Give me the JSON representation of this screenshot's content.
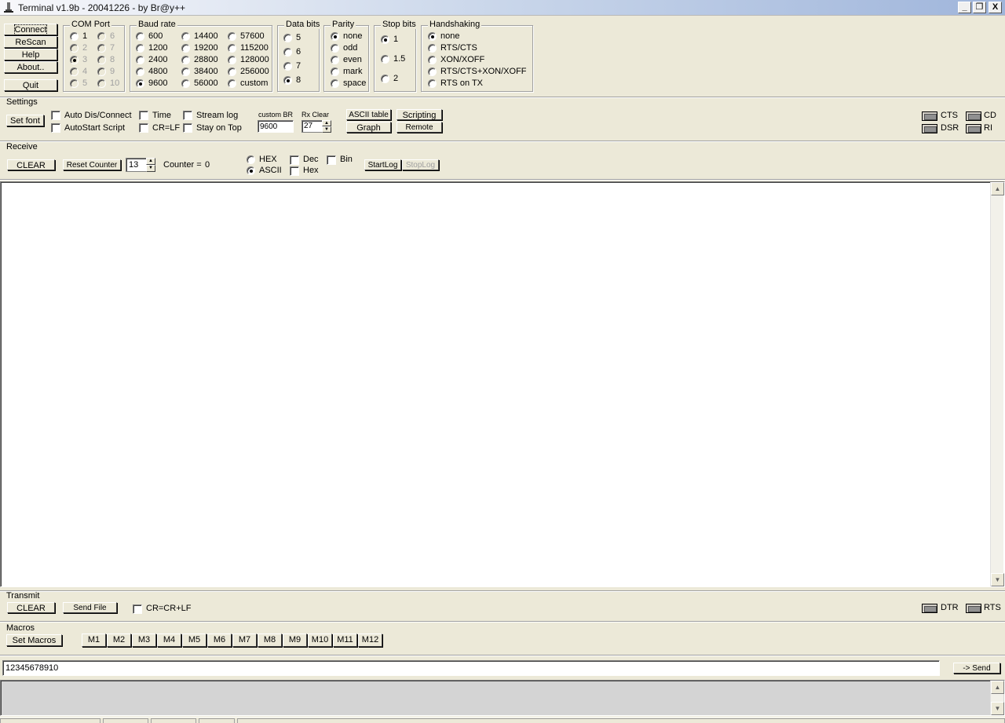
{
  "window": {
    "title": "Terminal v1.9b - 20041226 - by Br@y++",
    "minimize": "_",
    "restore": "❐",
    "close": "X"
  },
  "main_buttons": {
    "connect": "Connect",
    "rescan": "ReScan",
    "help": "Help",
    "about": "About..",
    "quit": "Quit"
  },
  "com_port": {
    "label": "COM Port",
    "options": [
      "1",
      "2",
      "3",
      "4",
      "5",
      "6",
      "7",
      "8",
      "9",
      "10"
    ],
    "selected": "3"
  },
  "baud_rate": {
    "label": "Baud rate",
    "options": [
      "600",
      "1200",
      "2400",
      "4800",
      "9600",
      "14400",
      "19200",
      "28800",
      "38400",
      "56000",
      "57600",
      "115200",
      "128000",
      "256000",
      "custom"
    ],
    "selected": "9600"
  },
  "data_bits": {
    "label": "Data bits",
    "options": [
      "5",
      "6",
      "7",
      "8"
    ],
    "selected": "8"
  },
  "parity": {
    "label": "Parity",
    "options": [
      "none",
      "odd",
      "even",
      "mark",
      "space"
    ],
    "selected": "none"
  },
  "stop_bits": {
    "label": "Stop bits",
    "options": [
      "1",
      "1.5",
      "2"
    ],
    "selected": "1"
  },
  "handshaking": {
    "label": "Handshaking",
    "options": [
      "none",
      "RTS/CTS",
      "XON/XOFF",
      "RTS/CTS+XON/XOFF",
      "RTS on TX"
    ],
    "selected": "none"
  },
  "settings": {
    "label": "Settings",
    "set_font": "Set font",
    "auto_dis_connect": "Auto Dis/Connect",
    "autostart_script": "AutoStart Script",
    "time": "Time",
    "cr_lf": "CR=LF",
    "stream_log": "Stream log",
    "stay_on_top": "Stay on Top",
    "custom_br_label": "custom BR",
    "custom_br_value": "9600",
    "rx_clear_label": "Rx Clear",
    "rx_clear_value": "27",
    "ascii_table": "ASCII table",
    "scripting": "Scripting",
    "graph": "Graph",
    "remote": "Remote"
  },
  "signals": {
    "cts": "CTS",
    "cd": "CD",
    "dsr": "DSR",
    "ri": "RI",
    "dtr": "DTR",
    "rts": "RTS"
  },
  "receive": {
    "label": "Receive",
    "clear": "CLEAR",
    "reset_counter": "Reset Counter",
    "counter_spin_value": "13",
    "counter_label": "Counter =",
    "counter_value": "0",
    "hex": "HEX",
    "ascii": "ASCII",
    "mode_selected": "ASCII",
    "dec": "Dec",
    "bin": "Bin",
    "hex_chk": "Hex",
    "start_log": "StartLog",
    "stop_log": "StopLog"
  },
  "transmit": {
    "label": "Transmit",
    "clear": "CLEAR",
    "send_file": "Send File",
    "cr_crlf": "CR=CR+LF"
  },
  "macros": {
    "label": "Macros",
    "set_macros": "Set Macros",
    "items": [
      "M1",
      "M2",
      "M3",
      "M4",
      "M5",
      "M6",
      "M7",
      "M8",
      "M9",
      "M10",
      "M11",
      "M12"
    ]
  },
  "send": {
    "input_value": "12345678910",
    "send_button": "-> Send"
  }
}
